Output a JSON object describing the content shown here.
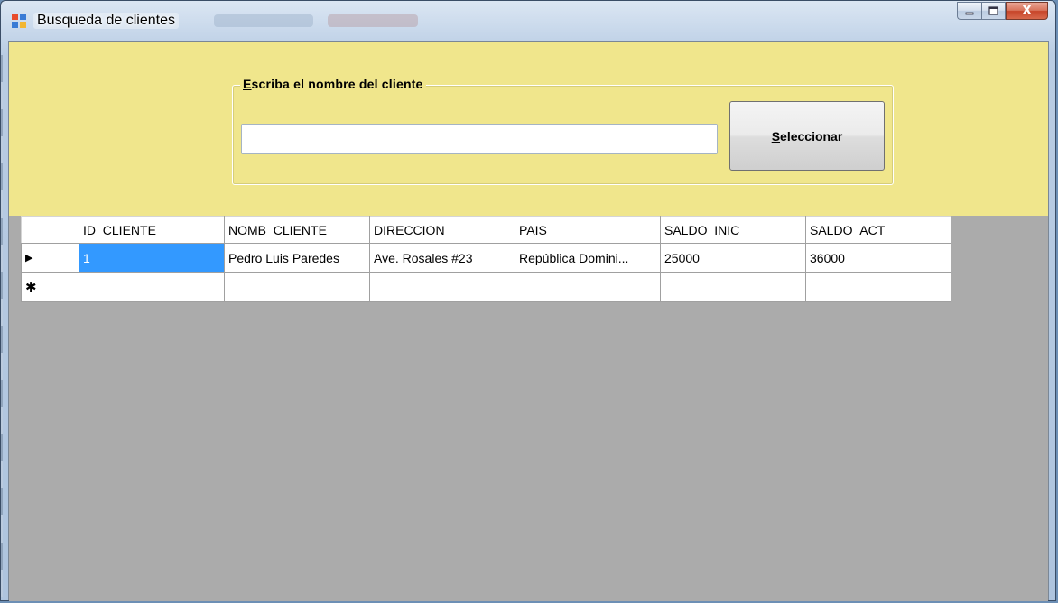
{
  "window": {
    "title": "Busqueda de clientes",
    "caption": {
      "minimize": "—",
      "maximize": "□",
      "close": "X"
    }
  },
  "search": {
    "group_label_access": "E",
    "group_label_rest": "scriba el nombre del cliente",
    "input_value": "",
    "button_access": "S",
    "button_rest": "eleccionar"
  },
  "grid": {
    "columns": [
      "ID_CLIENTE",
      "NOMB_CLIENTE",
      "DIRECCION",
      "PAIS",
      "SALDO_INIC",
      "SALDO_ACT"
    ],
    "rows": [
      {
        "indicator": "▶",
        "cells": [
          "1",
          "Pedro Luis Paredes",
          "Ave. Rosales #23",
          "República Domini...",
          "25000",
          "36000"
        ]
      },
      {
        "indicator": "✱",
        "cells": [
          "",
          "",
          "",
          "",
          "",
          ""
        ]
      }
    ]
  },
  "colors": {
    "panel": "#f0e68c",
    "grid_background": "#ababab",
    "selection": "#3399ff"
  }
}
